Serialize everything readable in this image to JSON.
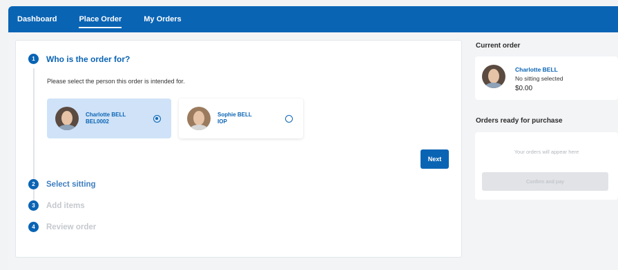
{
  "nav": {
    "tabs": [
      {
        "label": "Dashboard"
      },
      {
        "label": "Place Order"
      },
      {
        "label": "My Orders"
      }
    ],
    "active_tab": "Place Order"
  },
  "steps": [
    {
      "number": "1",
      "label": "Who is the order for?",
      "state": "active"
    },
    {
      "number": "2",
      "label": "Select sitting",
      "state": "next"
    },
    {
      "number": "3",
      "label": "Add items",
      "state": "disabled"
    },
    {
      "number": "4",
      "label": "Review order",
      "state": "disabled"
    }
  ],
  "step1": {
    "instruction": "Please select the person this order is intended for.",
    "people": [
      {
        "name": "Charlotte BELL",
        "id": "BEL0002",
        "selected": true
      },
      {
        "name": "Sophie BELL",
        "id": "IOP",
        "selected": false
      }
    ],
    "next_label": "Next"
  },
  "current_order": {
    "title": "Current order",
    "name": "Charlotte BELL",
    "status": "No sitting selected",
    "price": "$0.00"
  },
  "ready": {
    "title": "Orders ready for purchase",
    "empty_message": "Your orders will appear here",
    "confirm_label": "Confirm and pay"
  },
  "colors": {
    "primary": "#0a64b4",
    "selected_card": "#cfe2f7",
    "disabled_text": "#c4c8cd"
  },
  "icons": [
    "avatar-photo",
    "radio-checked",
    "radio-unchecked"
  ]
}
